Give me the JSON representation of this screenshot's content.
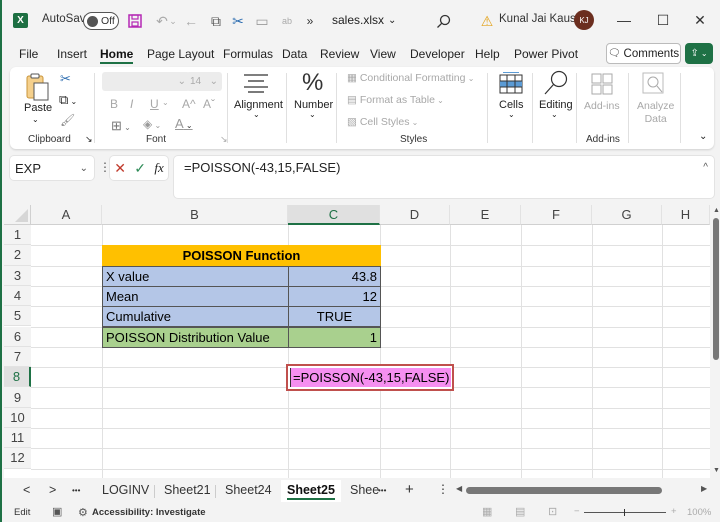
{
  "titlebar": {
    "app_icon": "excel-logo-icon",
    "app_icon_glyph": "X",
    "autosave_label": "AutoSave",
    "autosave_state": "Off",
    "quick_access": [
      {
        "name": "save-icon",
        "glyph": "💾"
      },
      {
        "name": "undo-icon",
        "glyph": "↶"
      },
      {
        "name": "undo-dropdown-icon",
        "glyph": "⌄"
      },
      {
        "name": "back-icon",
        "glyph": "←"
      },
      {
        "name": "copy-icon",
        "glyph": "⧉"
      },
      {
        "name": "cut-icon",
        "glyph": "✂"
      },
      {
        "name": "picture-icon",
        "glyph": "▭"
      },
      {
        "name": "spelling-icon",
        "glyph": "ab"
      },
      {
        "name": "more-commands-icon",
        "glyph": "»"
      }
    ],
    "filename": "sales.xlsx",
    "filename_chevron": "⌄",
    "search_icon": "⌕",
    "warning_icon": "⚠",
    "user_name": "Kunal Jai Kaushik",
    "user_initials": "KJ",
    "minimize": "—",
    "maximize": "☐",
    "close": "✕"
  },
  "menu": {
    "tabs": [
      "File",
      "Insert",
      "Home",
      "Page Layout",
      "Formulas",
      "Data",
      "Review",
      "View",
      "Developer",
      "Help",
      "Power Pivot"
    ],
    "active": "Home",
    "comments_label": "Comments",
    "comments_icon": "🗨",
    "share_icon": "⇪"
  },
  "ribbon": {
    "clipboard": {
      "paste_label": "Paste",
      "group_label": "Clipboard",
      "launcher": "↘"
    },
    "font": {
      "font_size": "14",
      "bold": "B",
      "italic": "I",
      "underline": "U",
      "grow": "A^",
      "shrink": "Aˇ",
      "group_label": "Font"
    },
    "alignment": {
      "label": "Alignment"
    },
    "number": {
      "label": "Number",
      "icon_glyph": "%"
    },
    "styles": {
      "conditional_formatting": "Conditional Formatting",
      "format_as_table": "Format as Table",
      "cell_styles": "Cell Styles",
      "group_label": "Styles"
    },
    "cells": {
      "label": "Cells"
    },
    "editing": {
      "label": "Editing"
    },
    "addins": {
      "label": "Add-ins",
      "group_label": "Add-ins"
    },
    "analyze": {
      "label_line1": "Analyze",
      "label_line2": "Data"
    },
    "collapse": "⌄"
  },
  "formula_bar": {
    "name_box": "EXP",
    "cancel_icon": "✕",
    "enter_icon": "✓",
    "fx_label": "fx",
    "formula": "=POISSON(-43,15,FALSE)",
    "expand_icon": "^"
  },
  "sheet": {
    "columns": [
      "A",
      "B",
      "C",
      "D",
      "E",
      "F",
      "G",
      "H"
    ],
    "selected_column": "C",
    "rows": [
      "1",
      "2",
      "3",
      "4",
      "5",
      "6",
      "7",
      "8",
      "9",
      "10",
      "11",
      "12"
    ],
    "selected_row": "8",
    "table": {
      "title": "POISSON Function",
      "title_color": "#ffc000",
      "rows": [
        {
          "label": "X value",
          "value": "43.8",
          "align": "right",
          "color": "#b4c6e7"
        },
        {
          "label": "Mean",
          "value": "12",
          "align": "right",
          "color": "#b4c6e7"
        },
        {
          "label": "Cumulative",
          "value": "TRUE",
          "align": "center",
          "color": "#b4c6e7"
        },
        {
          "label": "POISSON Distribution Value",
          "value": "1",
          "align": "right",
          "color": "#a9d08e"
        }
      ]
    },
    "editing_cell": {
      "ref": "C8",
      "text": "=POISSON(-43,15,FALSE)",
      "highlight": "#f58ff0",
      "border": "#c0504d"
    }
  },
  "sheet_tabs": {
    "prev": "<",
    "next": ">",
    "more_left": "•••",
    "tabs": [
      "LOGINV",
      "Sheet21",
      "Sheet24",
      "Sheet25",
      "Shee"
    ],
    "active": "Sheet25",
    "more_right": "•••",
    "add": "+"
  },
  "status_bar": {
    "mode": "Edit",
    "accessibility": "Accessibility: Investigate",
    "zoom": "100%",
    "zoom_minus": "−",
    "zoom_plus": "+"
  }
}
